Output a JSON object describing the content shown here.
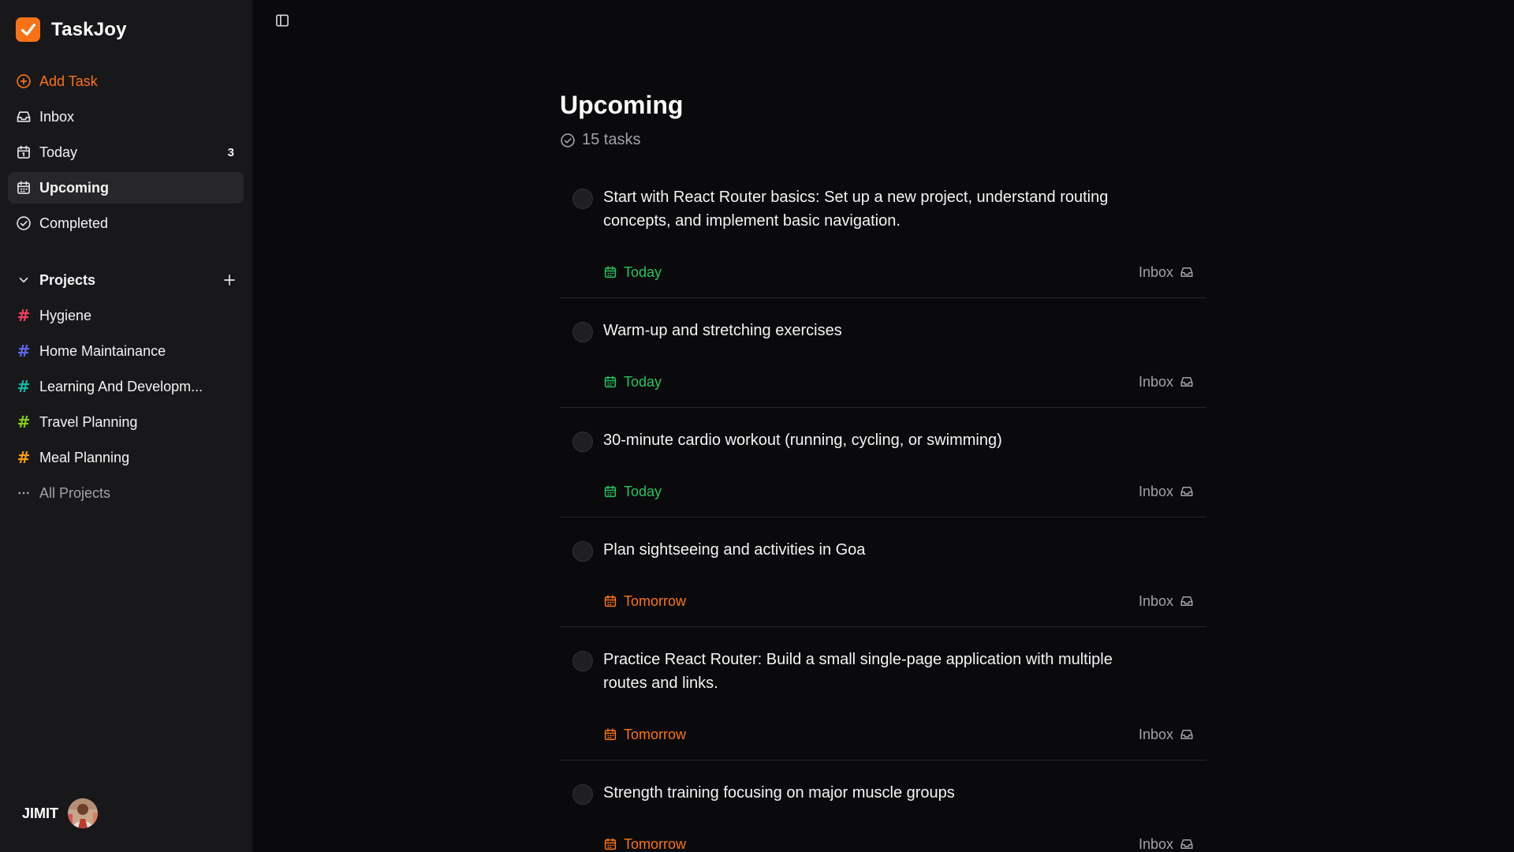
{
  "app": {
    "name": "TaskJoy",
    "accent": "#f97316"
  },
  "nav": {
    "add_task": "Add Task",
    "inbox": "Inbox",
    "today": "Today",
    "today_count": "3",
    "upcoming": "Upcoming",
    "completed": "Completed"
  },
  "projects": {
    "header": "Projects",
    "items": [
      {
        "label": "Hygiene",
        "color": "#f43f5e"
      },
      {
        "label": "Home Maintainance",
        "color": "#6366f1"
      },
      {
        "label": "Learning And Developm...",
        "color": "#14b8a6"
      },
      {
        "label": "Travel Planning",
        "color": "#84cc16"
      },
      {
        "label": "Meal Planning",
        "color": "#f59e0b"
      }
    ],
    "all_projects": "All Projects"
  },
  "user": {
    "name": "JIMIT"
  },
  "main": {
    "title": "Upcoming",
    "task_count": "15 tasks",
    "tasks": [
      {
        "title": "Start with React Router basics: Set up a new project, understand routing concepts, and implement basic navigation.",
        "due": "Today",
        "project": "Inbox"
      },
      {
        "title": "Warm-up and stretching exercises",
        "due": "Today",
        "project": "Inbox"
      },
      {
        "title": "30-minute cardio workout (running, cycling, or swimming)",
        "due": "Today",
        "project": "Inbox"
      },
      {
        "title": "Plan sightseeing and activities in Goa",
        "due": "Tomorrow",
        "project": "Inbox"
      },
      {
        "title": "Practice React Router: Build a small single-page application with multiple routes and links.",
        "due": "Tomorrow",
        "project": "Inbox"
      },
      {
        "title": "Strength training focusing on major muscle groups",
        "due": "Tomorrow",
        "project": "Inbox"
      }
    ]
  },
  "colors": {
    "today": "#22c55e",
    "tomorrow": "#f97316",
    "sidebar_bg": "#18181b",
    "main_bg": "#0a0a0c"
  }
}
